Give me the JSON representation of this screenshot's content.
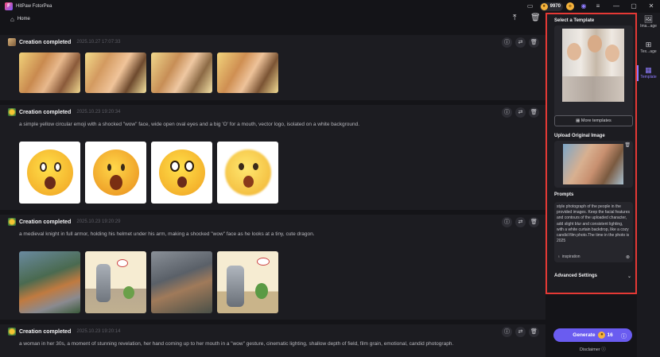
{
  "app": {
    "title": "HitPaw FotorPea",
    "credits": "9970"
  },
  "toolbar": {
    "home_label": "Home"
  },
  "cards": [
    {
      "title": "Creation completed",
      "time": "2025.10.27 17:07:33",
      "prompt": ""
    },
    {
      "title": "Creation completed",
      "time": "2025.10.23 19:20:34",
      "prompt": "a simple yellow circular emoji with a shocked \"wow\" face, wide open oval eyes and a big 'O' for a mouth, vector logo, isolated on a white background."
    },
    {
      "title": "Creation completed",
      "time": "2025.10.23 19:20:29",
      "prompt": "a medieval knight in full armor, holding his helmet under his arm, making a shocked \"wow\" face as he looks at a tiny, cute dragon."
    },
    {
      "title": "Creation completed",
      "time": "2025.10.23 19:20:14",
      "prompt": "a woman in her 30s, a moment of stunning revelation, her hand coming up to her mouth in a \"wow\" gesture, cinematic lighting, shallow depth of field, film grain, emotional, candid photograph."
    }
  ],
  "panel": {
    "select_template": "Select a Template",
    "more_templates": "More templates",
    "upload_title": "Upload Original Image",
    "prompts_title": "Prompts",
    "prompt_text": "style photograph of the people in the provided images.    Keep the facial features and contours of the uploaded character, add slight blur and consistent lighting, with a white curtain backdrop, like a cozy candid film photo.The time in the photo is 2025",
    "inspiration": "inspiration",
    "advanced": "Advanced Settings"
  },
  "generate": {
    "label": "Generate",
    "cost": "16"
  },
  "disclaimer": "Disclaimer",
  "rail": [
    {
      "label": "Ima...age",
      "icon": "image-icon"
    },
    {
      "label": "Tex...age",
      "icon": "text-image-icon"
    },
    {
      "label": "Template",
      "icon": "template-icon"
    }
  ],
  "colors": {
    "accent": "#6a5cf0",
    "highlight_border": "#e53935",
    "coin": "#f4b23c"
  }
}
